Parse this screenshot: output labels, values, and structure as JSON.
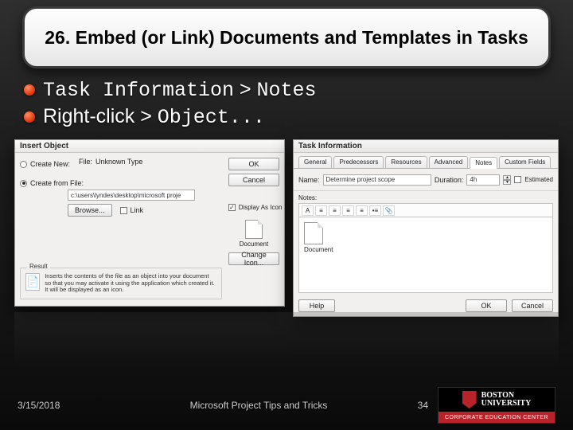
{
  "slide": {
    "title": "26. Embed (or Link) Documents and Templates in Tasks",
    "bullet1_mono1": "Task Information",
    "bullet1_gt": " > ",
    "bullet1_mono2": "Notes",
    "bullet2_plain": "Right-click > ",
    "bullet2_mono": "Object..."
  },
  "insert_object": {
    "title": "Insert Object",
    "create_new": "Create New:",
    "create_from_file": "Create from File:",
    "file_label": "File:",
    "file_type": "Unknown Type",
    "file_value": "c:\\users\\lyndes\\desktop\\microsoft proje",
    "browse": "Browse...",
    "link": "Link",
    "display_as_icon": "Display As Icon",
    "result_legend": "Result",
    "result_text": "Inserts the contents of the file as an object into your document so that you may activate it using the application which created it. It will be displayed as an icon.",
    "ok": "OK",
    "cancel": "Cancel",
    "doc_label": "Document",
    "change_icon": "Change Icon..."
  },
  "task_info": {
    "title": "Task Information",
    "tabs": [
      "General",
      "Predecessors",
      "Resources",
      "Advanced",
      "Notes",
      "Custom Fields"
    ],
    "active_tab_index": 4,
    "name_label": "Name:",
    "name_value": "Determine project scope",
    "duration_label": "Duration:",
    "duration_value": "4h",
    "estimated": "Estimated",
    "notes_label": "Notes:",
    "embedded_label": "Document",
    "help": "Help",
    "ok": "OK",
    "cancel": "Cancel",
    "toolbar_icons": [
      "A",
      "≡",
      "≡",
      "≡",
      "≡",
      "•≡",
      "📎"
    ]
  },
  "footer": {
    "date": "3/15/2018",
    "mid": "Microsoft Project Tips and Tricks",
    "page": "34",
    "logo_line1": "BOSTON",
    "logo_line2": "UNIVERSITY",
    "logo_sub": "CORPORATE EDUCATION CENTER"
  }
}
